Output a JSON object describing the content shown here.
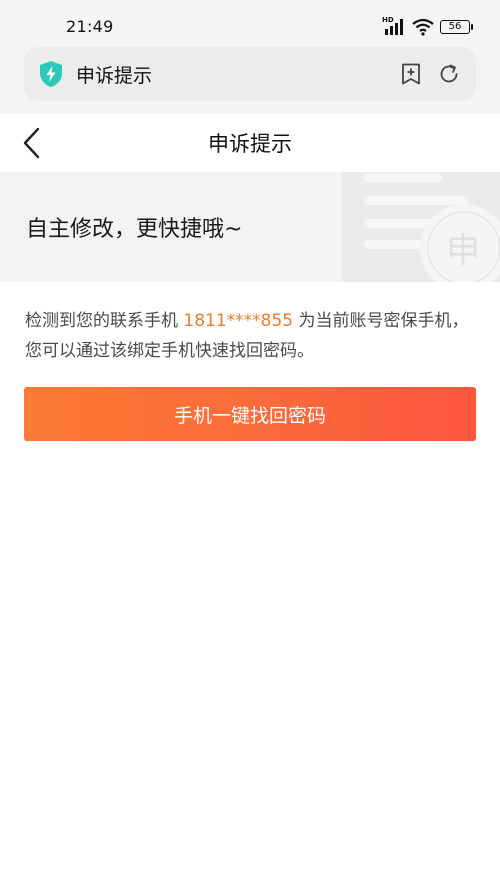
{
  "status_bar": {
    "time": "21:49",
    "network_label": "HD",
    "battery": "56"
  },
  "browser": {
    "address_title": "申诉提示",
    "shield_icon": "shield-lightning-icon",
    "bookmark_icon": "bookmark-plus-icon",
    "reload_icon": "reload-icon",
    "accent_color": "#2ec7b8"
  },
  "header": {
    "title": "申诉提示",
    "back_icon": "chevron-left-icon"
  },
  "banner": {
    "text": "自主修改，更快捷哦~",
    "deco_char": "申"
  },
  "description": {
    "prefix": "检测到您的联系手机 ",
    "phone": "1811****855",
    "suffix": " 为当前账号密保手机，您可以通过该绑定手机快速找回密码。",
    "phone_color": "#f07a2a"
  },
  "primary_button": {
    "label": "手机一键找回密码"
  }
}
